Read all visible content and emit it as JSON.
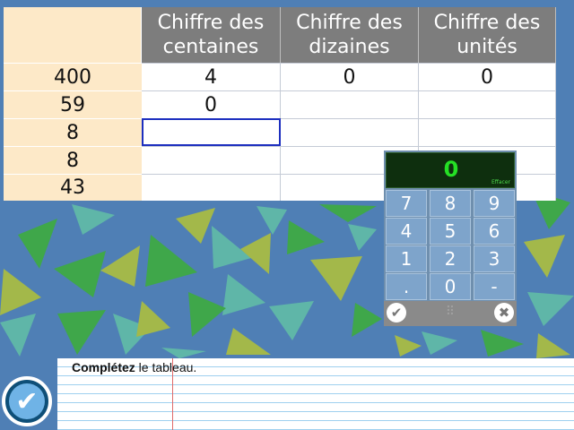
{
  "table": {
    "corner": "",
    "headers": [
      "Chiffre des centaines",
      "Chiffre des dizaines",
      "Chiffre des unités"
    ],
    "rows": [
      {
        "label": "400",
        "cells": [
          "4",
          "0",
          "0"
        ]
      },
      {
        "label": "59",
        "cells": [
          "0",
          "",
          ""
        ]
      },
      {
        "label": "8",
        "cells": [
          "",
          "",
          ""
        ]
      },
      {
        "label": "8",
        "cells": [
          "",
          "",
          ""
        ]
      },
      {
        "label": "43",
        "cells": [
          "",
          "",
          ""
        ]
      }
    ],
    "active_cell": {
      "row": 2,
      "col": 0
    }
  },
  "keypad": {
    "display": "0",
    "clear_label": "Effacer",
    "keys": [
      "7",
      "8",
      "9",
      "4",
      "5",
      "6",
      "1",
      "2",
      "3",
      ".",
      "0",
      "-"
    ],
    "ok_icon": "check-circle-icon",
    "cancel_icon": "close-circle-icon",
    "drag_icon": "drag-handle-icon"
  },
  "instruction": {
    "bold": "Complétez",
    "rest": " le tableau."
  },
  "colors": {
    "background": "#4f7fb5",
    "header": "#7d7d7d",
    "row_label": "#fde9c8",
    "active_border": "#1d2fbf",
    "display_green": "#25e025"
  }
}
